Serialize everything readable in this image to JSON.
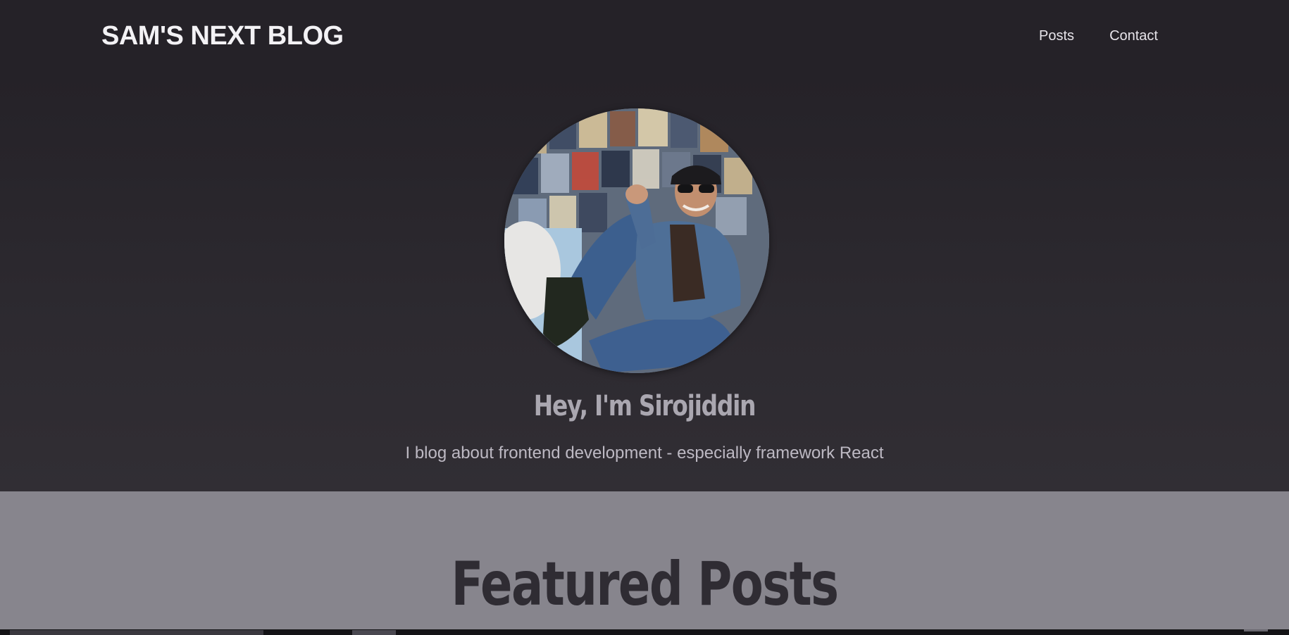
{
  "header": {
    "logo": "SAM'S NEXT BLOG",
    "nav": [
      {
        "label": "Posts"
      },
      {
        "label": "Contact"
      }
    ]
  },
  "hero": {
    "avatar_icon": "profile-photo",
    "title": "Hey, I'm Sirojiddin",
    "subtitle": "I blog about frontend development - especially framework React"
  },
  "featured": {
    "title": "Featured Posts"
  },
  "colors": {
    "header_bg": "#252228",
    "hero_bg": "#2d2a30",
    "featured_bg": "#87858d",
    "title_color": "#aaa7b0",
    "featured_title_color": "#2f2c33"
  }
}
